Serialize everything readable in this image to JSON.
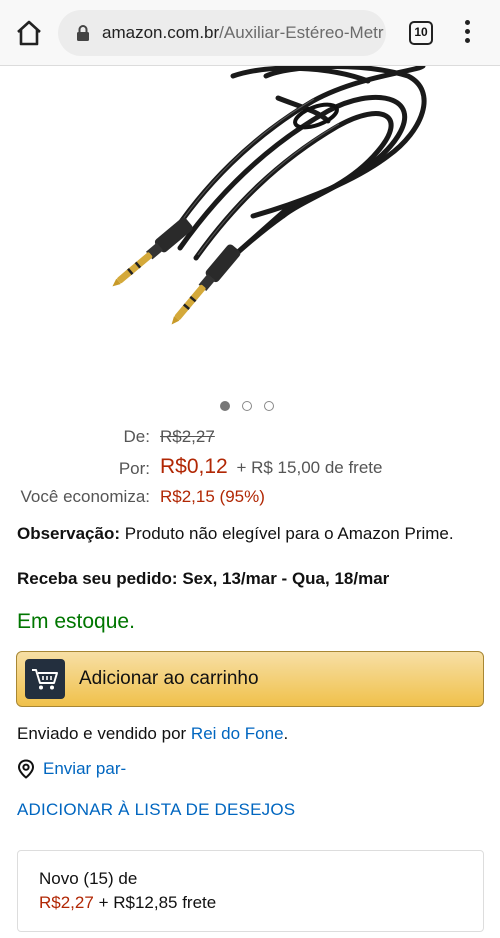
{
  "browser": {
    "url_host": "amazon.com.br",
    "url_path": "/Auxiliar-Estéreo-Metr",
    "tab_count": "10"
  },
  "carousel": {
    "dot_count": 3,
    "active_index": 0
  },
  "pricing": {
    "de_label": "De:",
    "de_value": "R$2,27",
    "por_label": "Por:",
    "por_value": "R$0,12",
    "shipping_note": "+ R$ 15,00 de frete",
    "economiza_label": "Você economiza:",
    "economiza_value": "R$2,15 (95%)"
  },
  "observation": {
    "label": "Observação:",
    "text": "Produto não elegível para o Amazon Prime."
  },
  "delivery": {
    "text": "Receba seu pedido: Sex, 13/mar - Qua, 18/mar"
  },
  "stock": {
    "text": "Em estoque."
  },
  "cart_button": {
    "label": "Adicionar ao carrinho"
  },
  "seller": {
    "prefix": "Enviado e vendido por",
    "name": "Rei do Fone",
    "suffix": "."
  },
  "ship_to": {
    "label": "Enviar par-"
  },
  "wishlist": {
    "label": "ADICIONAR À LISTA DE DESEJOS"
  },
  "offers": {
    "title": "Novo (15) de",
    "price": "R$2,27",
    "shipping": "+ R$12,85 frete"
  },
  "colors": {
    "price_red": "#b12704",
    "stock_green": "#007600",
    "link_blue": "#0066c0",
    "cart_yellow": "#f0c14b"
  }
}
